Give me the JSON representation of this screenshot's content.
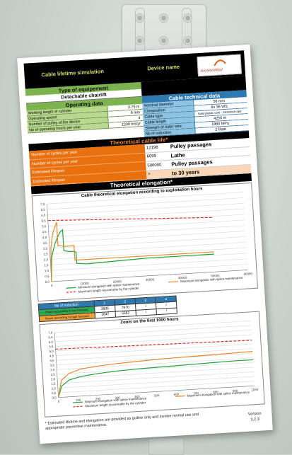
{
  "header": {
    "title": "Cable lifetime simulation",
    "device_name_label": "Device name",
    "logo_text": "ArcelorMittal"
  },
  "equipment": {
    "heading": "Type of equipement",
    "value": "Detachable chairlift"
  },
  "operating": {
    "heading": "Operating data",
    "rows": [
      {
        "label": "Working length of cylinder",
        "value": "2,75 m"
      },
      {
        "label": "Operating speed",
        "value": "6 m/s"
      },
      {
        "label": "Number of pulley of the device",
        "value": "4"
      },
      {
        "label": "Nb of operating hours per year",
        "value": "1200 hrs/yr"
      }
    ]
  },
  "cable": {
    "heading": "Cable technical data",
    "rows": [
      {
        "label": "Nominal diameter",
        "value": "56 mm"
      },
      {
        "label": "Composition",
        "value": "6x 36    WS"
      },
      {
        "label": "Cable type",
        "value": "Solid plastic core - Stranded rope"
      },
      {
        "label": "Cable length",
        "value": "4250 m"
      },
      {
        "label": "Strength of outer wire",
        "value": "1960 MPa"
      },
      {
        "label": "Nb of reduction",
        "value": "2 Rast"
      }
    ]
  },
  "life": {
    "heading": "Theoretical cable life*",
    "labels": [
      "Number of cycles per year",
      "Number of cycles per year",
      "Estimated lifespan",
      "Estimated lifespan"
    ],
    "rows": [
      {
        "num": "12198",
        "text": "Pulley passages"
      },
      {
        "num": "6099",
        "text": "Lathe"
      },
      {
        "num": "500000",
        "text": "Pulley passages"
      },
      {
        "num": ">",
        "text": "to     30    years"
      }
    ]
  },
  "elongation_heading": "Theoretical elongation*",
  "chart_data": [
    {
      "type": "line",
      "title": "Cable theoretical elongation according to exploitation hours",
      "xlim": [
        0,
        60000
      ],
      "ylim": [
        0,
        7
      ],
      "x_ticks": [
        "0",
        "10000",
        "20000",
        "30000",
        "40000",
        "50000",
        "60000"
      ],
      "y_ticks": [
        "0,0",
        "0,5",
        "1,0",
        "1,5",
        "2,0",
        "2,5",
        "3,0",
        "3,5",
        "4,0",
        "4,5",
        "5,0",
        "5,5",
        "6,0",
        "6,5",
        "7,0"
      ],
      "grid": true,
      "series": [
        {
          "name": "Minimum elongation with splice maintenance",
          "color": "#1fa33a",
          "x": [
            0,
            500,
            1500,
            2500,
            3500,
            4300,
            4300,
            6000,
            7500,
            8000,
            8000,
            11000,
            20000,
            30000,
            40000,
            50000
          ],
          "y": [
            0,
            2.2,
            3.2,
            3.9,
            4.4,
            4.6,
            2.7,
            2.6,
            2.6,
            2.5,
            1.5,
            1.4,
            1.5,
            1.6,
            1.6,
            1.6
          ]
        },
        {
          "name": "Maximum elongation with splice maintenance",
          "color": "#e8872a",
          "x": [
            0,
            400,
            1200,
            2000,
            2600,
            2600,
            4500,
            6500,
            7500,
            7500,
            12000,
            20000,
            30000,
            40000,
            50000
          ],
          "y": [
            0,
            3.0,
            4.3,
            4.9,
            5.3,
            3.2,
            3.1,
            3.1,
            3.1,
            1.8,
            1.8,
            1.8,
            1.8,
            1.8,
            1.8
          ]
        },
        {
          "name": "Maximum length recoverable by the cylinder",
          "color": "#e02020",
          "dashed": true,
          "x": [
            0,
            50000
          ],
          "y": [
            5.5,
            4.9
          ]
        }
      ]
    },
    {
      "type": "line",
      "title": "Zoom on the first 1000 hours",
      "xlim": [
        0,
        1000
      ],
      "ylim": [
        0,
        7
      ],
      "x_ticks": [
        "0",
        "100",
        "200",
        "300",
        "400",
        "500",
        "600",
        "700",
        "800",
        "900",
        "1000"
      ],
      "y_ticks": [
        "0,0",
        "0,5",
        "1,0",
        "1,5",
        "2,0",
        "2,5",
        "3,0",
        "3,5",
        "4,0",
        "4,5",
        "5,0",
        "5,5",
        "6,0",
        "6,5",
        "7,0"
      ],
      "grid": true,
      "series": [
        {
          "name": "Minimum elongation with splice maintenance",
          "color": "#1fa33a",
          "x": [
            0,
            20,
            60,
            120,
            200,
            300,
            400,
            500,
            600,
            700,
            800,
            900,
            1000
          ],
          "y": [
            0,
            1.2,
            1.8,
            2.1,
            2.3,
            2.45,
            2.55,
            2.6,
            2.65,
            2.7,
            2.75,
            2.8,
            2.8
          ]
        },
        {
          "name": "Maximum elongation with splice maintenance",
          "color": "#e8872a",
          "x": [
            0,
            20,
            60,
            120,
            200,
            300,
            400,
            500,
            600,
            700,
            800,
            900,
            1000
          ],
          "y": [
            0,
            1.8,
            2.5,
            2.9,
            3.1,
            3.25,
            3.35,
            3.45,
            3.5,
            3.55,
            3.6,
            3.65,
            3.7
          ]
        },
        {
          "name": "Maximum length recoverable by the cylinder",
          "color": "#e02020",
          "dashed": true,
          "x": [
            0,
            1000
          ],
          "y": [
            5.2,
            4.9
          ]
        }
      ]
    }
  ],
  "reduction": {
    "header": [
      "Nb of reduction",
      "1",
      "2",
      "3",
      "4"
    ],
    "rows": [
      {
        "label": "Hours according to low forecast",
        "values": [
          "3935",
          "7870",
          "/",
          "/"
        ]
      },
      {
        "label": "Hours according to high forecast",
        "values": [
          "1647",
          "5582",
          "/",
          "/"
        ]
      }
    ]
  },
  "footer": {
    "note": "* Estimated lifetime and elongation are provided as guiline only and involve normal use and appropriate preventive maintenance.",
    "version_label": "Version",
    "version": "3.2.3"
  }
}
